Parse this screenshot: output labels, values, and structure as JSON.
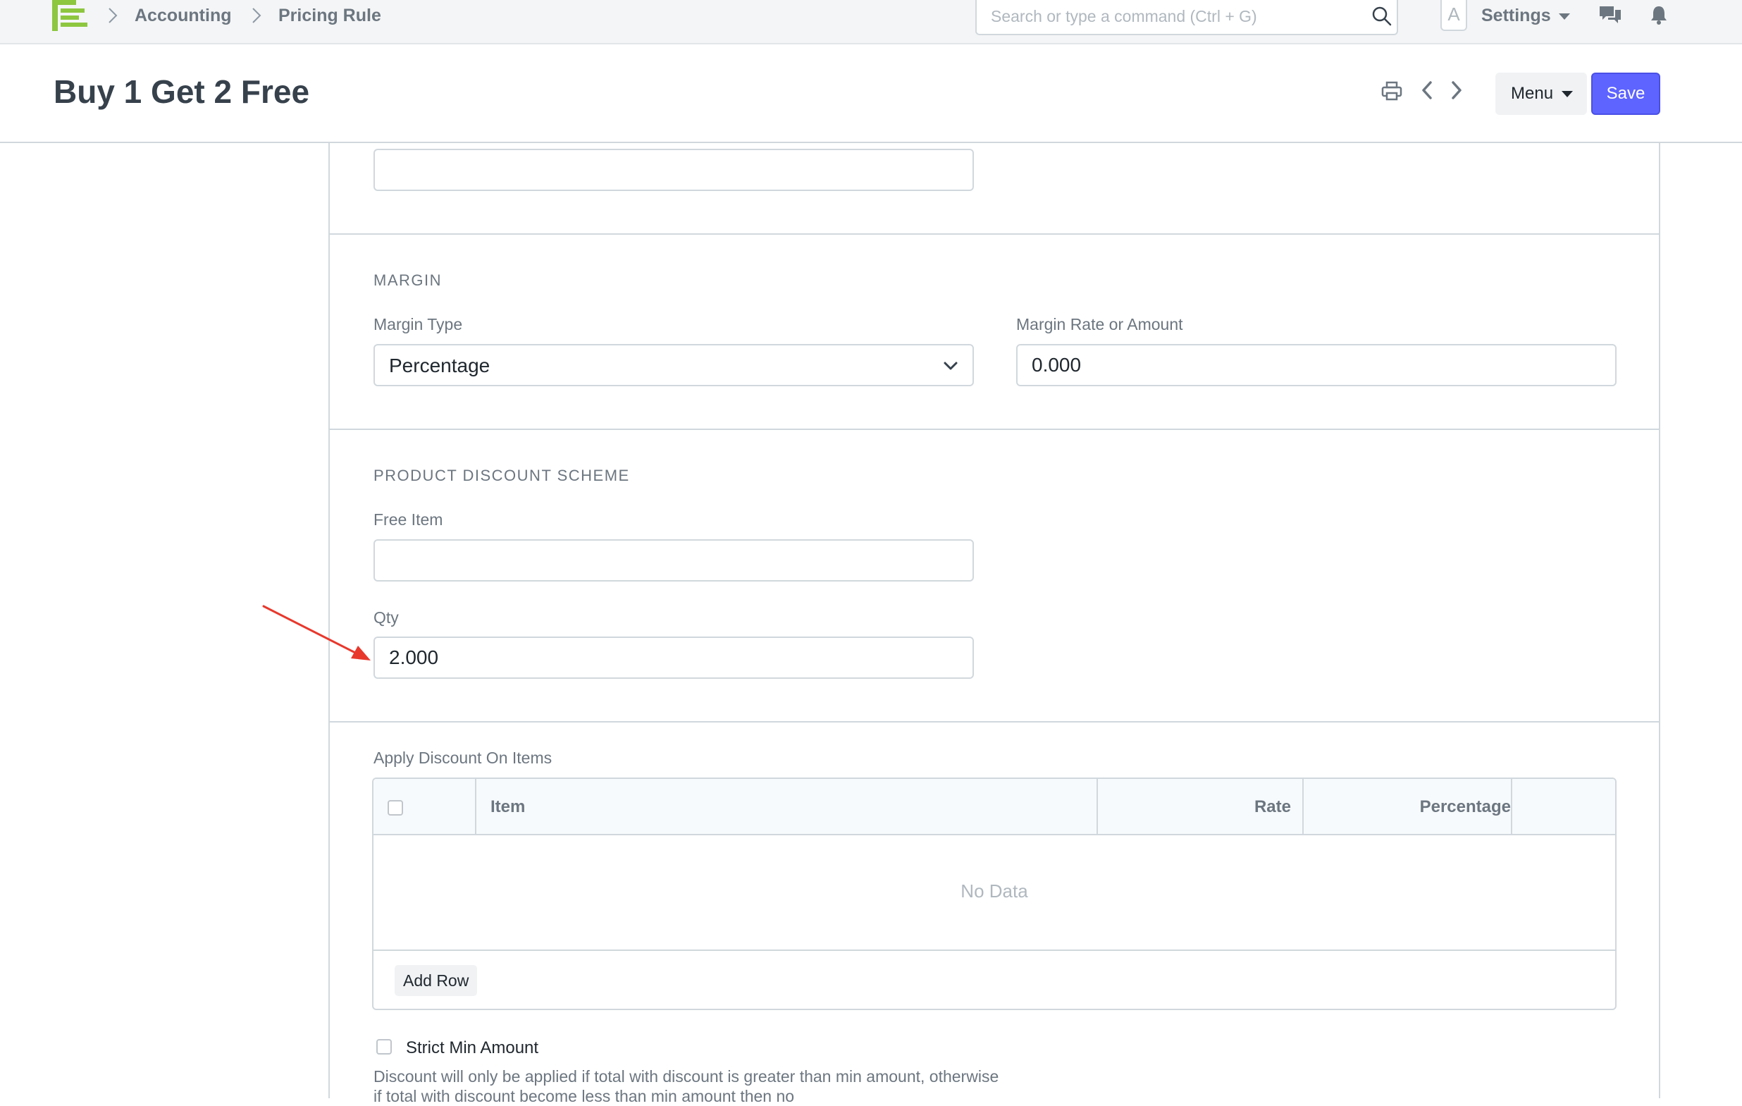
{
  "navbar": {
    "logo": "app-logo-icon",
    "breadcrumbs": [
      "Accounting",
      "Pricing Rule"
    ],
    "search_placeholder": "Search or type a command (Ctrl + G)",
    "avatar_letter": "A",
    "settings_label": "Settings"
  },
  "page": {
    "title": "Buy 1 Get 2 Free",
    "menu_label": "Menu",
    "save_label": "Save"
  },
  "top_field": {
    "value": ""
  },
  "margin": {
    "section_title": "MARGIN",
    "type_label": "Margin Type",
    "type_value": "Percentage",
    "rate_label": "Margin Rate or Amount",
    "rate_value": "0.000"
  },
  "product_discount": {
    "section_title": "PRODUCT DISCOUNT SCHEME",
    "free_item_label": "Free Item",
    "free_item_value": "",
    "qty_label": "Qty",
    "qty_value": "2.000"
  },
  "apply_discount": {
    "label": "Apply Discount On Items",
    "columns": [
      "Item",
      "Rate",
      "Percentage"
    ],
    "empty_text": "No Data",
    "add_row_label": "Add Row"
  },
  "strict_min": {
    "label": "Strict Min Amount",
    "help": "Discount will only be applied if total with discount is greater than min amount, otherwise if total with discount become less than min amount then no"
  },
  "colors": {
    "primary": "#5e64ff",
    "logo": "#8dc63f",
    "annotation_arrow": "#e8382c"
  }
}
